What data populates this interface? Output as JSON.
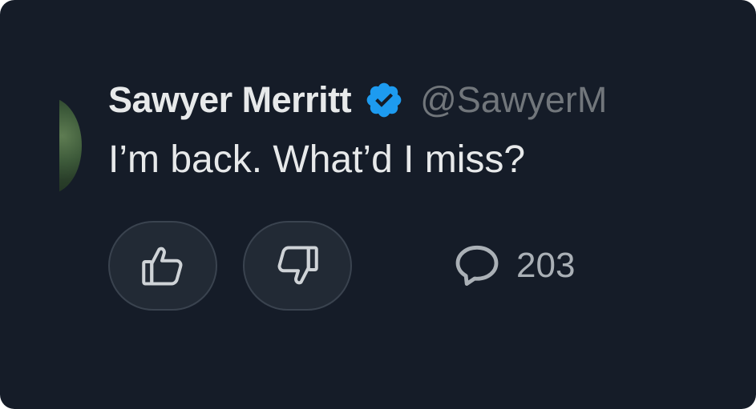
{
  "post": {
    "author_name": "Sawyer Merritt",
    "handle": "@SawyerM",
    "verified_icon": "verified-badge-icon",
    "text": "I’m back. What’d I miss?"
  },
  "actions": {
    "like_icon": "thumbs-up-icon",
    "dislike_icon": "thumbs-down-icon",
    "comment_icon": "speech-bubble-icon",
    "comment_count": "203"
  },
  "colors": {
    "background": "#151c28",
    "primary_text": "#e7e9ea",
    "secondary_text": "#71767b",
    "verified_blue": "#1d9bf0",
    "button_fill": "#222a35"
  }
}
